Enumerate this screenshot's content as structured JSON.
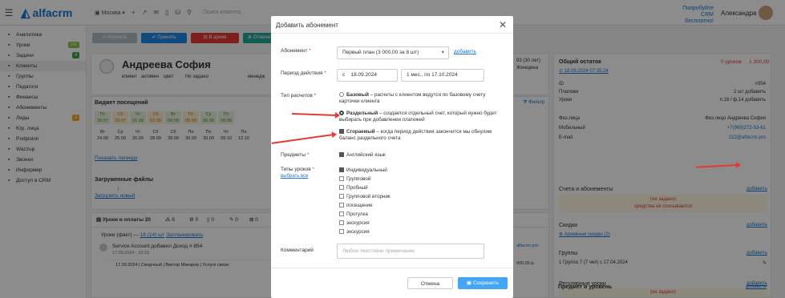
{
  "topbar": {
    "logo_text": "alfacrm",
    "branch": "Москва",
    "search_placeholder": "Поиск клиента",
    "free_crm_line1": "Попробуйте",
    "free_crm_line2": "CRM бесплатно!",
    "user_name": "Александра"
  },
  "sidebar": {
    "items": [
      {
        "label": "Аналитика",
        "icon": "chart-icon"
      },
      {
        "label": "Уроки",
        "icon": "calendar-icon",
        "badge": "142",
        "badge_color": "#8bc34a"
      },
      {
        "label": "Задачи",
        "icon": "tasks-icon",
        "badge": "9",
        "badge_color": "#43a047"
      },
      {
        "label": "Клиенты",
        "icon": "user-icon"
      },
      {
        "label": "Группы",
        "icon": "group-icon"
      },
      {
        "label": "Педагоги",
        "icon": "teacher-icon"
      },
      {
        "label": "Финансы",
        "icon": "money-icon"
      },
      {
        "label": "Абонементы",
        "icon": "tag-icon"
      },
      {
        "label": "Лиды",
        "icon": "lead-icon",
        "badge": "3",
        "badge_color": "#f9a825"
      },
      {
        "label": "Юр. лица",
        "icon": "building-icon"
      },
      {
        "label": "Podpislon",
        "icon": "doc-icon"
      },
      {
        "label": "Wazzup",
        "icon": "chat-icon"
      },
      {
        "label": "Звонки",
        "icon": "phone-icon"
      },
      {
        "label": "Информер",
        "icon": "info-icon"
      },
      {
        "label": "Доступ в CRM",
        "icon": "lock-icon"
      }
    ]
  },
  "client": {
    "actions": [
      "Вернуть",
      "Принять",
      "В архив",
      "Отмени"
    ],
    "name": "Андреева София",
    "chips": [
      "клиент",
      "активен",
      "цвет",
      "Не задано",
      "менедж"
    ],
    "visits_widget_title": "Виджет посещений",
    "filter_label": "Фильтр",
    "visit_days_top": [
      {
        "d": "Пт",
        "date": "28.07",
        "c": "#8bc34a"
      },
      {
        "d": "Сб",
        "date": "29.07",
        "c": "#f9a825"
      },
      {
        "d": "Чт",
        "date": "01.08",
        "c": "#8bc34a"
      },
      {
        "d": "Сб",
        "date": "03.08",
        "c": "#f9a825"
      },
      {
        "d": "Вт",
        "date": "04.08",
        "c": "#8bc34a"
      },
      {
        "d": "Пт",
        "date": "05.08",
        "c": "#f9a825"
      },
      {
        "d": "Ср",
        "date": "06.08",
        "c": "#8bc34a"
      },
      {
        "d": "Пт",
        "date": "08.08",
        "c": "#8bc34a"
      }
    ],
    "visit_days_bottom": [
      {
        "d": "Вт",
        "date": "24.09"
      },
      {
        "d": "Ср",
        "date": "25.09"
      },
      {
        "d": "Чт",
        "date": "26.09"
      },
      {
        "d": "Сб",
        "date": "28.09"
      },
      {
        "d": "Сб",
        "date": "28.09"
      },
      {
        "d": "Пн",
        "date": "30.09"
      },
      {
        "d": "Пн",
        "date": "30.09"
      },
      {
        "d": "Чт",
        "date": "09.10"
      },
      {
        "d": "Пн",
        "date": "12.10"
      }
    ],
    "show_legend": "Показать легенду",
    "files_title": "Загруженные файлы",
    "upload_new": "Загрузить новый",
    "tabs": [
      "Уроки и оплаты",
      "20",
      "6",
      "0",
      "0",
      "0",
      "0"
    ],
    "lessons_fact": "Уроки (факт) —",
    "lessons_fact_count": "18 (14) шт",
    "plan_label": "Запланировать",
    "feed_title": "Service Account добавил Доход # 854",
    "feed_date": "17.09.2024 · 20:15",
    "feed_line": "17.09.2024 | Сводчный | Виктор Макаров | Услуги связи",
    "mid_text1": "93 (30 лет)",
    "mid_text2": "Женщина",
    "mid_link": "alfacrm.pro",
    "mid_amount": "000,00 р."
  },
  "right_panel": {
    "total_title": "Общий остаток",
    "total_lessons": "0 уроков",
    "total_money": "1 300,00",
    "date_link": "18.09.2024 07:35:24",
    "rows": [
      {
        "k": "ID",
        "v": "#354"
      },
      {
        "k": "Платежи",
        "v": "2 шт  добавить"
      },
      {
        "k": "Уроки",
        "v": "п.18 / ф.14  добавить"
      }
    ],
    "person_rows": [
      {
        "k": "Физ.лица",
        "v": "Физ.лицо Андреева София"
      },
      {
        "k": "Мобильный",
        "v": "+7(969)272-53-61"
      },
      {
        "k": "E-mail",
        "v": "222@alfacrm.pro"
      }
    ],
    "accounts_title": "Счета и абонементы",
    "add_label": "добавить",
    "not_set": "(не задано)",
    "not_debited": "средства не списываются",
    "discounts_title": "Скидки",
    "archive_discounts": "Архивные скидки (2)",
    "groups_title": "Группы",
    "group_line": "1 Группа 7 (7 чел) с 17.04.2024",
    "regular_title": "Регулярные уроки",
    "subject_title": "Предмет и уровень"
  },
  "modal": {
    "title": "Добавить абонемент",
    "subscription_label": "Абонемент",
    "subscription_value": "Первый план (3 000,00 за 8 шт)",
    "add_link": "добавить",
    "period_label": "Период действия",
    "period_prefix": "с",
    "period_from": "18.09.2024",
    "period_to": "1 мес., по 17.10.2024",
    "calc_type_label": "Тип расчетов",
    "calc_basic_title": "Базовый",
    "calc_basic_desc": " – расчеты с клиентом ведутся по базовому счету карточки клиента",
    "calc_separate_title": "Раздельный",
    "calc_separate_desc": " – создается отдельный счет, который нужно будет выбирать при добавлении платежей",
    "burn_title": "Сгораемый",
    "burn_desc": " – когда период действия закончится мы обнулим баланс раздельного счета",
    "subjects_label": "Предметы",
    "subject_value": "Английский язык",
    "lesson_types_label": "Типы уроков",
    "select_all": "выбрать все",
    "lesson_types": [
      {
        "label": "Индивидуальный",
        "checked": true
      },
      {
        "label": "Групповой",
        "checked": false
      },
      {
        "label": "Пробный",
        "checked": false
      },
      {
        "label": "Групповой вторник",
        "checked": false
      },
      {
        "label": "посещение",
        "checked": false
      },
      {
        "label": "Прогулка",
        "checked": false
      },
      {
        "label": "экскурсия",
        "checked": false
      },
      {
        "label": "экскурсия",
        "checked": false
      }
    ],
    "comment_label": "Комментарий",
    "comment_placeholder": "Любое текстовое примечание",
    "cancel": "Отмена",
    "save": "Сохранить"
  },
  "colors": {
    "accent": "#1976d2",
    "alert": "#e53935",
    "primary_button": "#42a5f5"
  }
}
